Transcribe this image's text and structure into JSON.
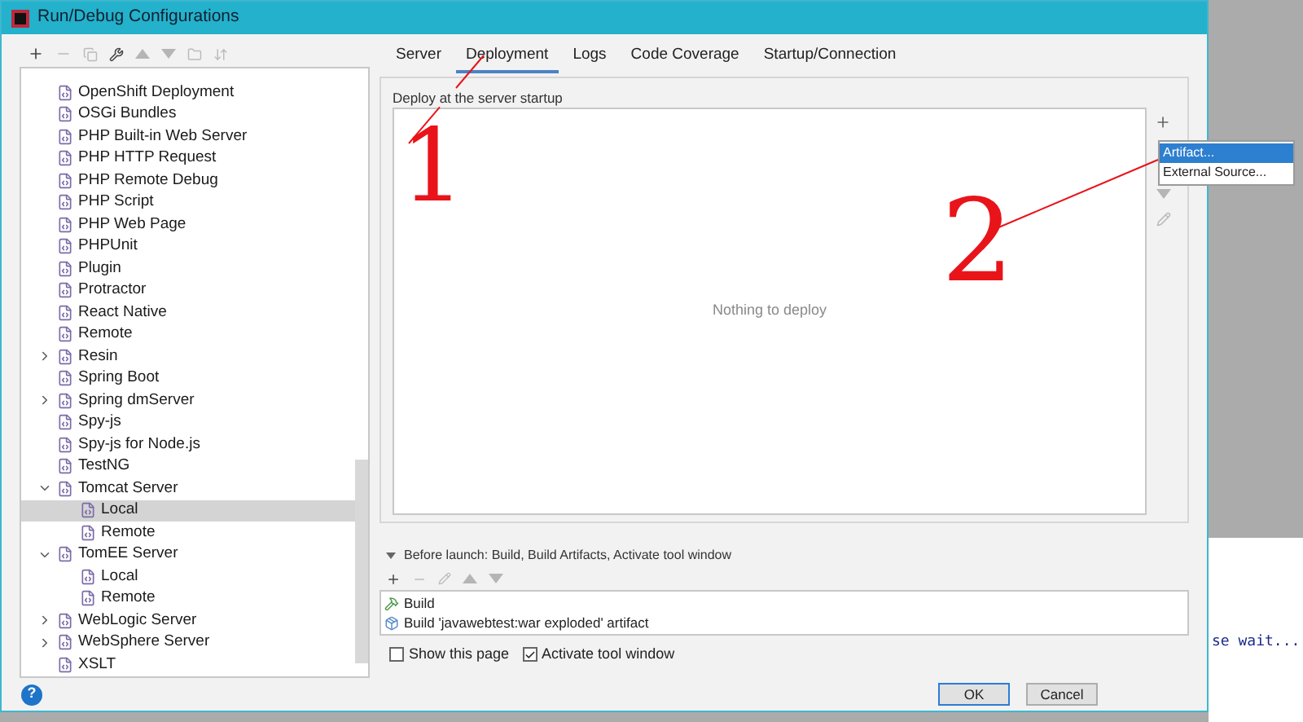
{
  "window": {
    "title": "Run/Debug Configurations"
  },
  "tree": [
    {
      "label": "OpenShift Deployment"
    },
    {
      "label": "OSGi Bundles"
    },
    {
      "label": "PHP Built-in Web Server"
    },
    {
      "label": "PHP HTTP Request"
    },
    {
      "label": "PHP Remote Debug"
    },
    {
      "label": "PHP Script"
    },
    {
      "label": "PHP Web Page"
    },
    {
      "label": "PHPUnit"
    },
    {
      "label": "Plugin"
    },
    {
      "label": "Protractor"
    },
    {
      "label": "React Native"
    },
    {
      "label": "Remote"
    },
    {
      "label": "Resin",
      "expanded": false
    },
    {
      "label": "Spring Boot"
    },
    {
      "label": "Spring dmServer",
      "expanded": false
    },
    {
      "label": "Spy-js"
    },
    {
      "label": "Spy-js for Node.js"
    },
    {
      "label": "TestNG"
    },
    {
      "label": "Tomcat Server",
      "expanded": true,
      "children": [
        {
          "label": "Local",
          "selected": true
        },
        {
          "label": "Remote",
          "selected": false
        }
      ]
    },
    {
      "label": "TomEE Server",
      "expanded": true,
      "children": [
        {
          "label": "Local",
          "selected": false
        },
        {
          "label": "Remote",
          "selected": false
        }
      ]
    },
    {
      "label": "WebLogic Server",
      "expanded": false
    },
    {
      "label": "WebSphere Server",
      "expanded": false
    },
    {
      "label": "XSLT"
    }
  ],
  "tabs": [
    {
      "label": "Server",
      "selected": false
    },
    {
      "label": "Deployment",
      "selected": true
    },
    {
      "label": "Logs",
      "selected": false
    },
    {
      "label": "Code Coverage",
      "selected": false
    },
    {
      "label": "Startup/Connection",
      "selected": false
    }
  ],
  "deploy": {
    "title": "Deploy at the server startup",
    "empty_text": "Nothing to deploy"
  },
  "add_menu": [
    {
      "label": "Artifact...",
      "selected": true
    },
    {
      "label": "External Source...",
      "selected": false
    }
  ],
  "before_launch": {
    "title": "Before launch: Build, Build Artifacts, Activate tool window",
    "expanded": true,
    "items": [
      {
        "label": "Build",
        "kind": "build"
      },
      {
        "label": "Build 'javawebtest:war exploded' artifact",
        "kind": "artifact"
      }
    ]
  },
  "options": [
    {
      "label": "Show this page",
      "checked": false
    },
    {
      "label": "Activate tool window",
      "checked": true
    }
  ],
  "buttons": [
    "OK",
    "Cancel"
  ],
  "help": "?",
  "annotations": [
    "1",
    "2"
  ],
  "background": {
    "console_text": "se wait..."
  }
}
